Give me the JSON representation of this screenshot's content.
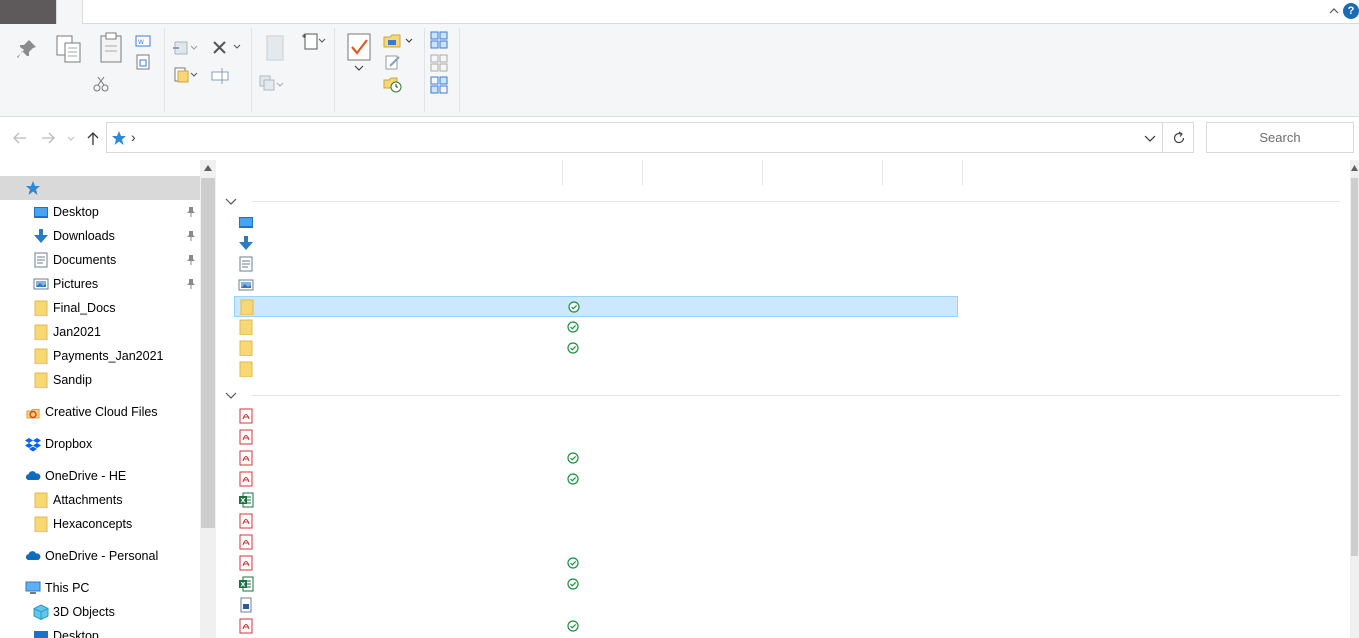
{
  "search": {
    "placeholder": "Search"
  },
  "address": {
    "separator": "›"
  },
  "help": {
    "label": "?"
  },
  "navpane": {
    "quick_access_items": [
      {
        "label": "Desktop",
        "icon": "desktop-icon",
        "pinned": true
      },
      {
        "label": "Downloads",
        "icon": "downloads-icon",
        "pinned": true
      },
      {
        "label": "Documents",
        "icon": "documents-icon",
        "pinned": true
      },
      {
        "label": "Pictures",
        "icon": "pictures-icon",
        "pinned": true
      },
      {
        "label": "Final_Docs",
        "icon": "folder-icon",
        "pinned": false
      },
      {
        "label": "Jan2021",
        "icon": "folder-icon",
        "pinned": false
      },
      {
        "label": "Payments_Jan2021",
        "icon": "folder-icon",
        "pinned": false
      },
      {
        "label": "Sandip",
        "icon": "folder-icon",
        "pinned": false
      }
    ],
    "creative_cloud": "Creative Cloud Files",
    "dropbox": "Dropbox",
    "onedrive_he": "OneDrive - HE",
    "onedrive_he_children": [
      "Attachments",
      "Hexaconcepts"
    ],
    "onedrive_personal": "OneDrive - Personal",
    "this_pc": "This PC",
    "this_pc_children": [
      "3D Objects",
      "Desktop"
    ]
  },
  "content": {
    "folders": [
      {
        "icon": "desktop-icon",
        "synced": false,
        "selected": false
      },
      {
        "icon": "downloads-icon",
        "synced": false,
        "selected": false
      },
      {
        "icon": "documents-icon",
        "synced": false,
        "selected": false
      },
      {
        "icon": "pictures-icon",
        "synced": false,
        "selected": false
      },
      {
        "icon": "folder-icon",
        "synced": true,
        "selected": true
      },
      {
        "icon": "folder-icon",
        "synced": true,
        "selected": false
      },
      {
        "icon": "folder-icon",
        "synced": true,
        "selected": false
      },
      {
        "icon": "folder-icon",
        "synced": false,
        "selected": false
      }
    ],
    "recent_files": [
      {
        "icon": "pdf-icon",
        "synced": false
      },
      {
        "icon": "pdf-icon",
        "synced": false
      },
      {
        "icon": "pdf-icon",
        "synced": true
      },
      {
        "icon": "pdf-icon",
        "synced": true
      },
      {
        "icon": "excel-icon",
        "synced": false
      },
      {
        "icon": "pdf-icon",
        "synced": false
      },
      {
        "icon": "pdf-icon",
        "synced": false
      },
      {
        "icon": "pdf-icon",
        "synced": true
      },
      {
        "icon": "excel-icon",
        "synced": true
      },
      {
        "icon": "word-doc-icon",
        "synced": false
      },
      {
        "icon": "pdf-icon",
        "synced": true
      }
    ]
  },
  "colors": {
    "selection_bg": "#cce8ff",
    "selection_border": "#99d1ff",
    "sync_green": "#1e8e3e",
    "folder_yellow": "#f8d775",
    "pdf_red": "#d13438",
    "excel_green": "#1d6f42",
    "accent_blue": "#1a73c8"
  }
}
